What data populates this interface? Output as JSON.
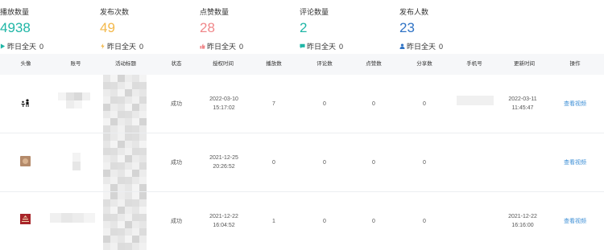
{
  "stats": [
    {
      "label": "播放数量",
      "value": "4938",
      "color": "#1fb6a6",
      "yest_label": "昨日全天",
      "yest_value": "0",
      "icon": "play-icon",
      "icon_color": "#1fb6a6"
    },
    {
      "label": "发布次数",
      "value": "49",
      "color": "#f3b84a",
      "yest_label": "昨日全天",
      "yest_value": "0",
      "icon": "lightning-icon",
      "icon_color": "#f3b84a"
    },
    {
      "label": "点赞数量",
      "value": "28",
      "color": "#f0878a",
      "yest_label": "昨日全天",
      "yest_value": "0",
      "icon": "thumbs-up-icon",
      "icon_color": "#f0878a"
    },
    {
      "label": "评论数量",
      "value": "2",
      "color": "#1fb6a6",
      "yest_label": "昨日全天",
      "yest_value": "0",
      "icon": "comment-icon",
      "icon_color": "#1fb6a6"
    },
    {
      "label": "发布人数",
      "value": "23",
      "color": "#2f73c5",
      "yest_label": "昨日全天",
      "yest_value": "0",
      "icon": "user-icon",
      "icon_color": "#2f73c5"
    }
  ],
  "table": {
    "headers": {
      "avatar": "头像",
      "account": "账号",
      "title": "活动标题",
      "status": "状态",
      "auth_time": "授权时间",
      "plays": "播放数",
      "comments": "评论数",
      "likes": "点赞数",
      "shares": "分享数",
      "phone": "手机号",
      "updated": "更新时间",
      "action": "操作"
    },
    "rows": [
      {
        "avatar_icon": "black-figure-avatar",
        "status": "成功",
        "auth_time": "2022-03-10 15:17:02",
        "plays": "7",
        "comments": "0",
        "likes": "0",
        "shares": "0",
        "updated": "2022-03-11 11:45:47",
        "action": "查看视频"
      },
      {
        "avatar_icon": "photo-avatar",
        "status": "成功",
        "auth_time": "2021-12-25 20:26:52",
        "plays": "0",
        "comments": "0",
        "likes": "0",
        "shares": "0",
        "updated": "",
        "action": "查看视频"
      },
      {
        "avatar_icon": "red-logo-avatar",
        "status": "成功",
        "auth_time": "2021-12-22 16:04:52",
        "plays": "1",
        "comments": "0",
        "likes": "0",
        "shares": "0",
        "updated": "2021-12-22 16:16:00",
        "action": "查看视频"
      }
    ]
  }
}
